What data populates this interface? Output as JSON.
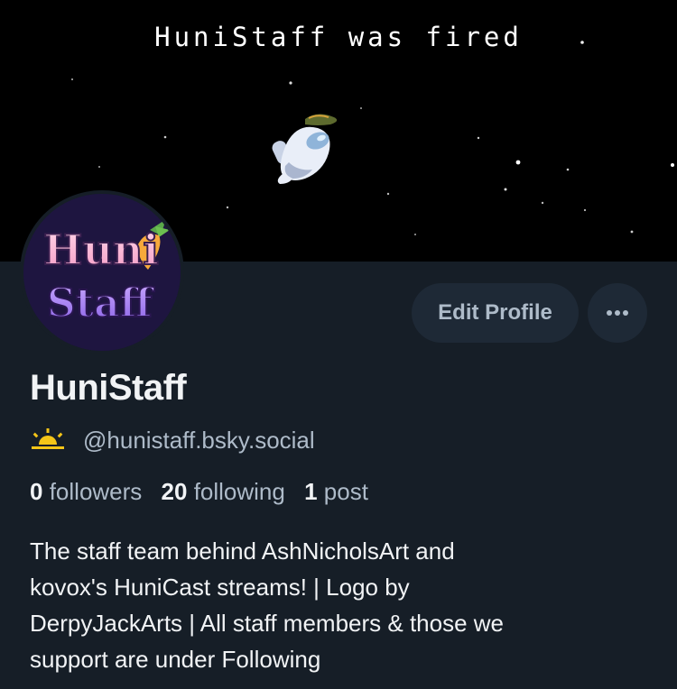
{
  "banner": {
    "caption": "HuniStaff was fired"
  },
  "avatar": {
    "logo_top": "Huni",
    "logo_bottom": "Staff"
  },
  "actions": {
    "edit_profile_label": "Edit Profile",
    "more_label": "..."
  },
  "profile": {
    "display_name": "HuniStaff",
    "handle": "@hunistaff.bsky.social",
    "badge_icon": "sunrise-icon"
  },
  "stats": {
    "followers_count": "0",
    "followers_label": "followers",
    "following_count": "20",
    "following_label": "following",
    "posts_count": "1",
    "posts_label": "post"
  },
  "bio": {
    "lines": [
      "The staff team behind AshNicholsArt and",
      "kovox's HuniCast streams! | Logo by",
      "DerpyJackArts | All staff members & those we",
      "support are under Following"
    ]
  },
  "colors": {
    "background": "#161e27",
    "button_bg": "#1e2936",
    "muted_text": "#aebbc9",
    "primary_text": "#f1f3f5",
    "badge": "#f5c518"
  }
}
